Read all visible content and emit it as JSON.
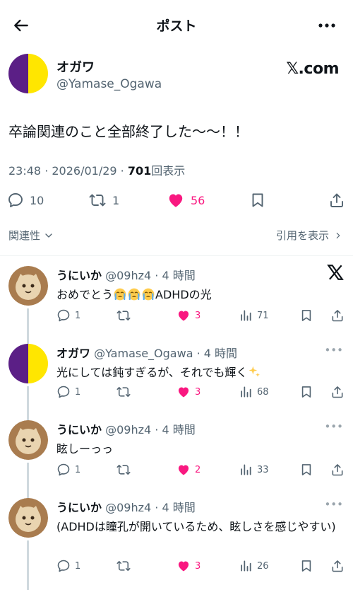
{
  "header": {
    "title": "ポスト"
  },
  "post": {
    "author_name": "オガワ",
    "author_handle": "@Yamase_Ogawa",
    "source_badge": "𝕏.com",
    "text": "卒論関連のこと全部終了した〜〜！！",
    "timestamp": "23:48 · 2026/01/29 · ",
    "views": "701",
    "views_label": "回表示",
    "stats": {
      "replies": "10",
      "reposts": "1",
      "likes": "56"
    }
  },
  "related": {
    "left_label": "関連性",
    "right_label": "引用を表示"
  },
  "colors": {
    "like": "#f91880",
    "secondary": "#536471",
    "avatar_purple": "#5b1f86",
    "avatar_yellow": "#ffe600"
  },
  "replies": [
    {
      "name": "うにいか",
      "handle_time": "@09hz4 · 4 時間",
      "text": "おめでとう",
      "text_suffix": "ADHDの光",
      "emoji": [
        "crying-face",
        "crying-face",
        "crying-face"
      ],
      "stats": {
        "replies": "1",
        "likes": "3",
        "views": "71"
      }
    },
    {
      "name": "オガワ",
      "handle_time": "@Yamase_Ogawa · 4 時間",
      "text": "光にしては鈍すぎるが、それでも輝く",
      "emoji": [
        "sparkles"
      ],
      "stats": {
        "replies": "1",
        "likes": "3",
        "views": "68"
      }
    },
    {
      "name": "うにいか",
      "handle_time": "@09hz4 · 4 時間",
      "text": "眩しーっっ",
      "stats": {
        "replies": "1",
        "likes": "2",
        "views": "33"
      }
    },
    {
      "name": "うにいか",
      "handle_time": "@09hz4 · 4 時間",
      "text": "(ADHDは瞳孔が開いているため、眩しさを感じやすい)",
      "stats": {
        "replies": "1",
        "likes": "3",
        "views": "26"
      }
    }
  ]
}
